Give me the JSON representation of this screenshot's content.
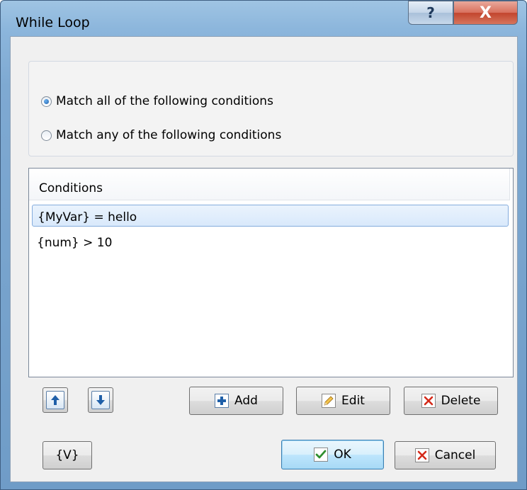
{
  "window": {
    "title": "While Loop",
    "help_symbol": "?",
    "close_symbol": "X"
  },
  "match_options": [
    {
      "label": "Match all of the following conditions",
      "checked": true
    },
    {
      "label": "Match any of the following conditions",
      "checked": false
    }
  ],
  "conditions": {
    "header": "Conditions",
    "rows": [
      {
        "text": "{MyVar} = hello",
        "selected": true
      },
      {
        "text": "{num} > 10",
        "selected": false
      }
    ]
  },
  "toolbar": {
    "add_label": "Add",
    "edit_label": "Edit",
    "delete_label": "Delete"
  },
  "footer": {
    "variable_label": "{V}",
    "ok_label": "OK",
    "cancel_label": "Cancel"
  },
  "icons": {
    "move_up": "arrow-up-icon",
    "move_down": "arrow-down-icon",
    "add": "plus-icon",
    "edit": "pencil-icon",
    "delete": "x-icon",
    "ok": "checkmark-icon",
    "cancel": "x-icon"
  },
  "colors": {
    "accent_blue": "#1f5fa8",
    "delete_red": "#d42a1a",
    "ok_green": "#2f8f2f",
    "selection": "#d9e9fb"
  }
}
